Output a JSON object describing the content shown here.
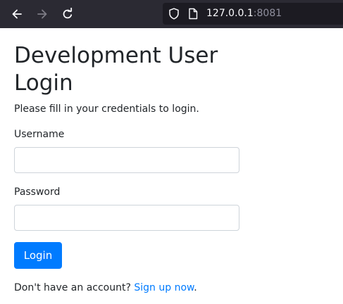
{
  "browser": {
    "url_host": "127.0.0.1",
    "url_port": ":8081"
  },
  "page": {
    "title": "Development User Login",
    "intro": "Please fill in your credentials to login.",
    "username_label": "Username",
    "username_value": "",
    "password_label": "Password",
    "password_value": "",
    "login_button": "Login",
    "signup_prompt": "Don't have an account?",
    "signup_link": "Sign up now",
    "signup_suffix": "."
  },
  "colors": {
    "toolbar": "#2b2a33",
    "urlbar": "#1c1b22",
    "primary": "#007bff",
    "text": "#212529",
    "input_border": "#ced4da"
  },
  "icons": {
    "back": "arrow-left-icon",
    "forward": "arrow-right-icon",
    "reload": "reload-icon",
    "tracking_protection": "shield-icon",
    "page": "page-icon"
  }
}
